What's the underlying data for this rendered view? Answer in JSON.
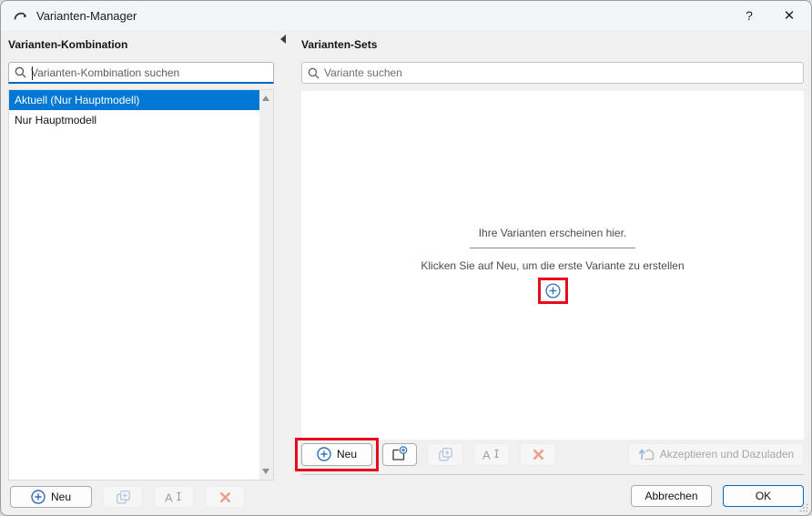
{
  "window": {
    "title": "Varianten-Manager",
    "help_label": "?",
    "close_label": "✕"
  },
  "left_panel": {
    "title": "Varianten-Kombination",
    "search_placeholder": "Varianten-Kombination suchen",
    "items": [
      {
        "label": "Aktuell (Nur Hauptmodell)",
        "selected": true
      },
      {
        "label": "Nur Hauptmodell",
        "selected": false
      }
    ],
    "buttons": {
      "new_label": "Neu"
    }
  },
  "right_panel": {
    "title": "Varianten-Sets",
    "search_placeholder": "Variante suchen",
    "empty_state": {
      "line1": "Ihre Varianten erscheinen hier.",
      "line2": "Klicken Sie auf Neu, um die erste Variante zu erstellen"
    },
    "buttons": {
      "new_label": "Neu",
      "accept_label": "Akzeptieren und Dazuladen"
    }
  },
  "footer": {
    "cancel_label": "Abbrechen",
    "ok_label": "OK"
  },
  "icons": {
    "titlebar": "arc-icon",
    "search": "search-icon",
    "new": "circled-plus-icon",
    "duplicate": "duplicate-icon",
    "rename": "rename-icon",
    "delete": "delete-x-icon",
    "new_from": "new-folder-icon",
    "accept": "upload-house-icon"
  },
  "colors": {
    "accent_blue": "#0078d4",
    "focus_blue": "#0067c0",
    "annotation_red": "#e60c1e"
  }
}
